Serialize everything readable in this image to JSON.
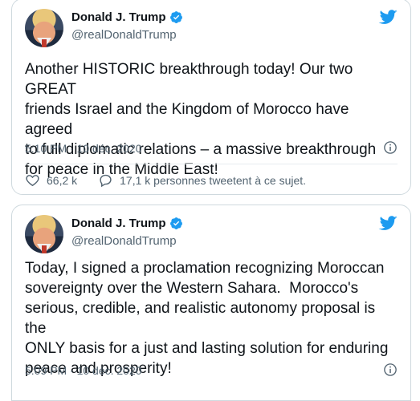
{
  "tweets": [
    {
      "name": "Donald J. Trump",
      "handle": "@realDonaldTrump",
      "text": "Another HISTORIC breakthrough today! Our two GREAT\nfriends Israel and the Kingdom of Morocco have agreed\nto full diplomatic relations – a massive breakthrough\nfor peace in the Middle East!",
      "timestamp": "5:10 PM · 10 déc. 2020",
      "likes": "66,2 k",
      "discussion": "17,1 k personnes tweetent à ce sujet."
    },
    {
      "name": "Donald J. Trump",
      "handle": "@realDonaldTrump",
      "text": "Today, I signed a proclamation recognizing Moroccan\nsovereignty over the Western Sahara.  Morocco's\nserious, credible, and realistic autonomy proposal is the\nONLY basis for a just and lasting solution for enduring\npeace and prosperity!",
      "timestamp": "5:09 PM · 10 déc. 2020"
    }
  ],
  "colors": {
    "twitter_blue": "#1d9bf0",
    "secondary_text": "#536471",
    "border": "#cfd9de"
  },
  "icons": [
    "twitter-bird-icon",
    "verified-badge-icon",
    "info-icon",
    "heart-icon",
    "comment-icon"
  ]
}
